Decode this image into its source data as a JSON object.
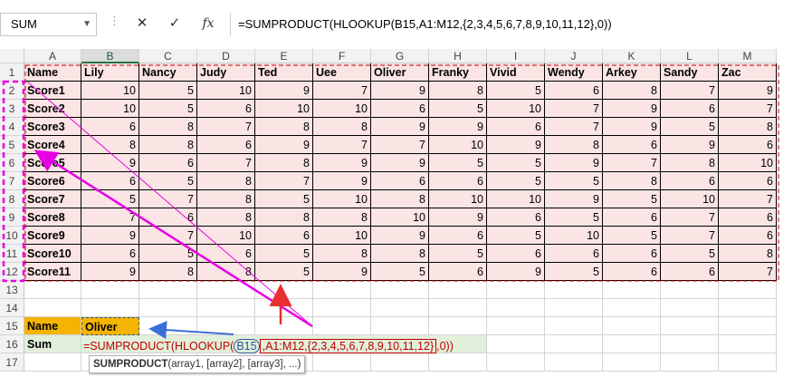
{
  "name_box": {
    "value": "SUM"
  },
  "formula_bar": {
    "cancel_icon": "close-icon",
    "enter_icon": "check-icon",
    "fx_label": "fx",
    "formula": "=SUMPRODUCT(HLOOKUP(B15,A1:M12,{2,3,4,5,6,7,8,9,10,11,12},0))"
  },
  "columns": [
    "A",
    "B",
    "C",
    "D",
    "E",
    "F",
    "G",
    "H",
    "I",
    "J",
    "K",
    "L",
    "M"
  ],
  "rows": [
    "1",
    "2",
    "3",
    "4",
    "5",
    "6",
    "7",
    "8",
    "9",
    "10",
    "11",
    "12",
    "13",
    "14",
    "15",
    "16",
    "17"
  ],
  "table": {
    "header": [
      "Name",
      "Lily",
      "Nancy",
      "Judy",
      "Ted",
      "Uee",
      "Oliver",
      "Franky",
      "Vivid",
      "Wendy",
      "Arkey",
      "Sandy",
      "Zac"
    ],
    "rows": [
      {
        "name": "Score1",
        "values": [
          10,
          5,
          10,
          9,
          7,
          9,
          8,
          5,
          6,
          8,
          7,
          9
        ]
      },
      {
        "name": "Score2",
        "values": [
          10,
          5,
          6,
          10,
          10,
          6,
          5,
          10,
          7,
          9,
          6,
          7
        ]
      },
      {
        "name": "Score3",
        "values": [
          6,
          8,
          7,
          8,
          8,
          9,
          9,
          6,
          7,
          9,
          5,
          8
        ]
      },
      {
        "name": "Score4",
        "values": [
          8,
          8,
          6,
          9,
          7,
          7,
          10,
          9,
          8,
          6,
          9,
          6
        ]
      },
      {
        "name": "Score5",
        "values": [
          9,
          6,
          7,
          8,
          9,
          9,
          5,
          5,
          9,
          7,
          8,
          10
        ]
      },
      {
        "name": "Score6",
        "values": [
          6,
          5,
          8,
          7,
          9,
          6,
          6,
          5,
          5,
          8,
          6,
          6
        ]
      },
      {
        "name": "Score7",
        "values": [
          5,
          7,
          8,
          5,
          10,
          8,
          10,
          10,
          9,
          5,
          10,
          7
        ]
      },
      {
        "name": "Score8",
        "values": [
          7,
          6,
          8,
          8,
          8,
          10,
          9,
          6,
          5,
          6,
          7,
          6
        ]
      },
      {
        "name": "Score9",
        "values": [
          9,
          7,
          10,
          6,
          10,
          9,
          6,
          5,
          10,
          5,
          7,
          6
        ]
      },
      {
        "name": "Score10",
        "values": [
          6,
          5,
          6,
          5,
          8,
          8,
          5,
          6,
          6,
          6,
          5,
          8
        ]
      },
      {
        "name": "Score11",
        "values": [
          9,
          8,
          8,
          5,
          9,
          5,
          6,
          9,
          5,
          6,
          6,
          7
        ]
      }
    ]
  },
  "lookup": {
    "label_a15": "Name",
    "value_b15": "Oliver",
    "label_a16": "Sum"
  },
  "cell_edit": {
    "prefix": "=SUMPRODUCT(HLOOKUP(",
    "ref_b15": "B15",
    "comma1": ",",
    "ref_range": "A1:M12",
    "array_const": ",{2,3,4,5,6,7,8,9,10,11,12}",
    "suffix": ",0))"
  },
  "tooltip": {
    "func": "SUMPRODUCT",
    "args": "(array1, [array2], [array3], ...)"
  },
  "colors": {
    "table_fill": "#fbe4e4",
    "header_cell_fill": "#f4b400",
    "edit_row_fill": "#e2efda",
    "arrow_magenta": "#e600e6",
    "arrow_red": "#e83030",
    "arrow_blue": "#3b6fd8"
  }
}
